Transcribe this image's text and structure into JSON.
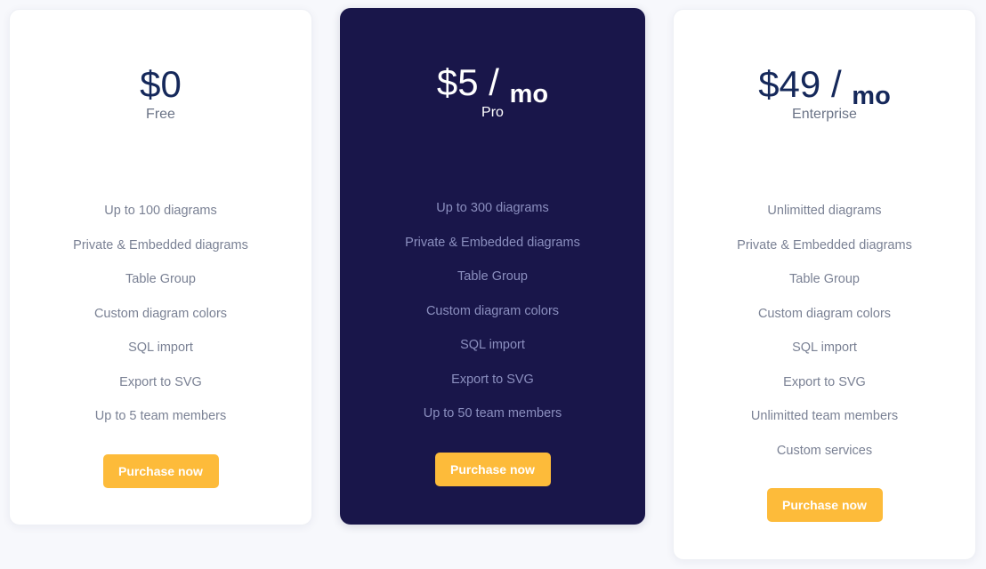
{
  "colors": {
    "background": "#f7f8fc",
    "card": "#ffffff",
    "featured_card": "#19164a",
    "price_text": "#15285a",
    "button": "#fdbb3a"
  },
  "plans": [
    {
      "price": "$0",
      "period": "",
      "name": "Free",
      "features": [
        "Up to 100 diagrams",
        "Private & Embedded diagrams",
        "Table Group",
        "Custom diagram colors",
        "SQL import",
        "Export to SVG",
        "Up to 5 team members"
      ],
      "button_label": "Purchase now"
    },
    {
      "price": "$5 / ",
      "period": "mo",
      "name": "Pro",
      "features": [
        "Up to 300 diagrams",
        "Private & Embedded diagrams",
        "Table Group",
        "Custom diagram colors",
        "SQL import",
        "Export to SVG",
        "Up to 50 team members"
      ],
      "button_label": "Purchase now"
    },
    {
      "price": "$49 / ",
      "period": "mo",
      "name": "Enterprise",
      "features": [
        "Unlimitted diagrams",
        "Private & Embedded diagrams",
        "Table Group",
        "Custom diagram colors",
        "SQL import",
        "Export to SVG",
        "Unlimitted team members",
        "Custom services"
      ],
      "button_label": "Purchase now"
    }
  ]
}
